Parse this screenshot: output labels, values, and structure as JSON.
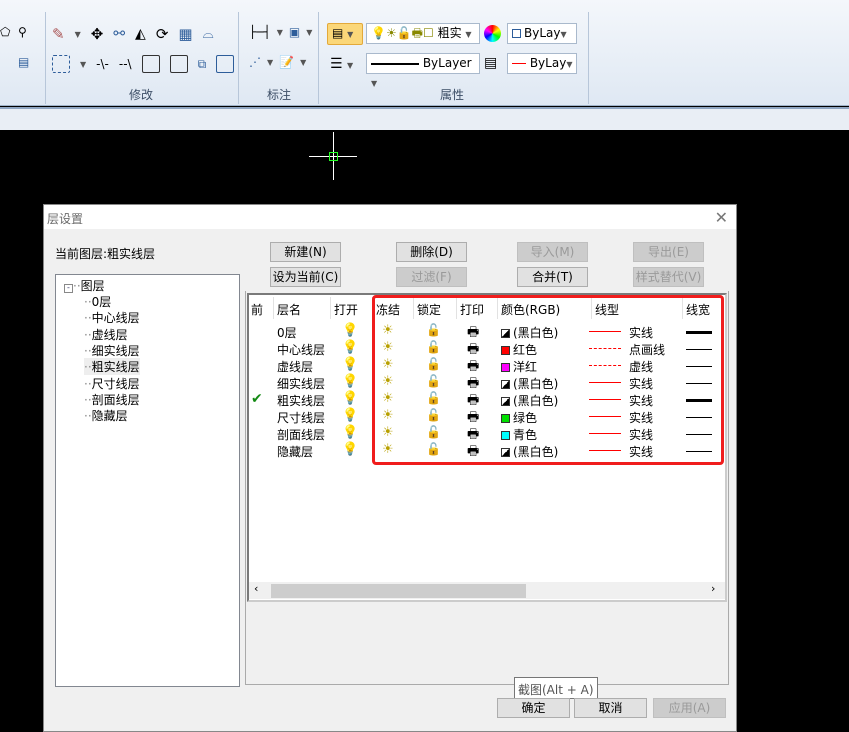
{
  "ribbon": {
    "groups": [
      {
        "label": "修改"
      },
      {
        "label": "标注"
      },
      {
        "label": "属性"
      }
    ],
    "layer_combo": "粗实",
    "color_combo": "ByLay",
    "linetype_combo": "ByLayer",
    "lineweight_combo": "ByLay"
  },
  "dialog": {
    "title": "层设置",
    "current_layer_label": "当前图层:粗实线层",
    "buttons": {
      "new": "新建(N)",
      "delete": "删除(D)",
      "import": "导入(M)",
      "export": "导出(E)",
      "set_current": "设为当前(C)",
      "filter": "过滤(F)",
      "merge": "合并(T)",
      "style_override": "样式替代(V)"
    },
    "tree": {
      "root": "图层",
      "children": [
        "0层",
        "中心线层",
        "虚线层",
        "细实线层",
        "粗实线层",
        "尺寸线层",
        "剖面线层",
        "隐藏层"
      ],
      "selected": "粗实线层"
    },
    "columns": [
      "前",
      "层名",
      "打开",
      "冻结",
      "锁定",
      "打印",
      "颜色(RGB)",
      "线型",
      "线宽"
    ],
    "rows": [
      {
        "current": false,
        "name": "0层",
        "on": true,
        "color": "(黑白色)",
        "swatch": "bw",
        "linetype_style": "solid",
        "linetype": "实线",
        "lineweight": "thick"
      },
      {
        "current": false,
        "name": "中心线层",
        "on": true,
        "color": "红色",
        "swatch": "#ff0000",
        "linetype_style": "dashdot",
        "linetype": "点画线",
        "lineweight": "thin"
      },
      {
        "current": false,
        "name": "虚线层",
        "on": true,
        "color": "洋红",
        "swatch": "#ff00ff",
        "linetype_style": "dashed",
        "linetype": "虚线",
        "lineweight": "thin"
      },
      {
        "current": false,
        "name": "细实线层",
        "on": true,
        "color": "(黑白色)",
        "swatch": "bw",
        "linetype_style": "solid",
        "linetype": "实线",
        "lineweight": "thin"
      },
      {
        "current": true,
        "name": "粗实线层",
        "on": true,
        "color": "(黑白色)",
        "swatch": "bw",
        "linetype_style": "solid",
        "linetype": "实线",
        "lineweight": "thick"
      },
      {
        "current": false,
        "name": "尺寸线层",
        "on": true,
        "color": "绿色",
        "swatch": "#00e000",
        "linetype_style": "solid",
        "linetype": "实线",
        "lineweight": "thin"
      },
      {
        "current": false,
        "name": "剖面线层",
        "on": true,
        "color": "青色",
        "swatch": "#00ffff",
        "linetype_style": "solid",
        "linetype": "实线",
        "lineweight": "thin"
      },
      {
        "current": false,
        "name": "隐藏层",
        "on": false,
        "color": "(黑白色)",
        "swatch": "bw",
        "linetype_style": "solid",
        "linetype": "实线",
        "lineweight": "thin"
      }
    ],
    "tooltip": "截图(Alt + A)",
    "ok": "确定",
    "cancel": "取消",
    "apply": "应用(A)",
    "highlight_color": "#f01d1d"
  }
}
